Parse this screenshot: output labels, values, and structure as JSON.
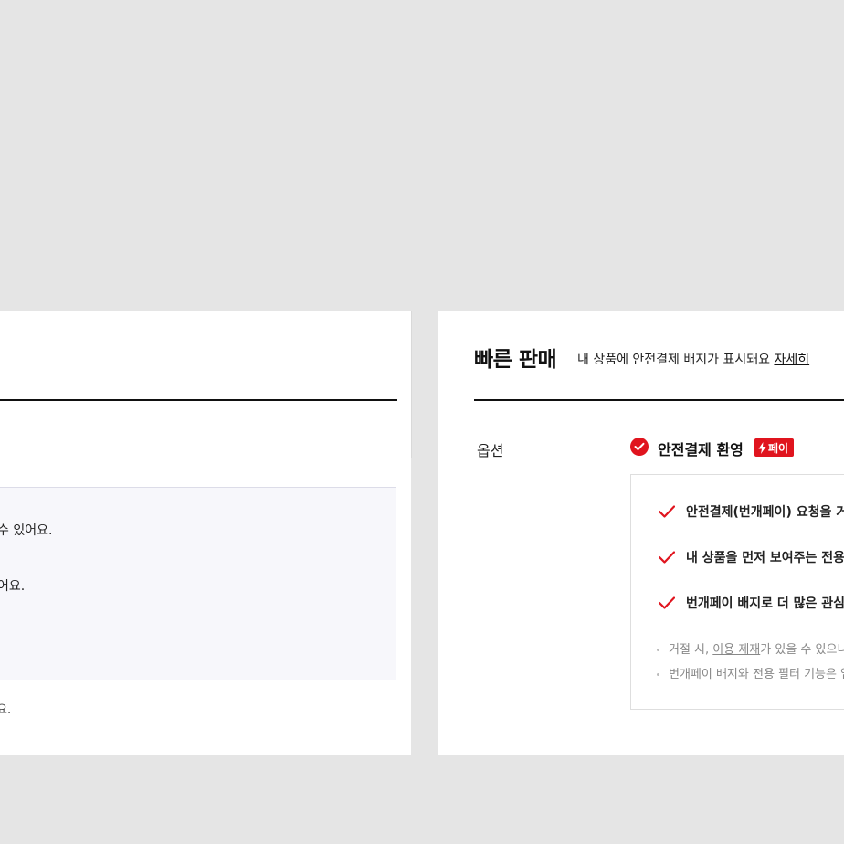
{
  "left_panel": {
    "line1": "수 있어요.",
    "line2": "어요.",
    "line3": "요."
  },
  "right_panel": {
    "title": "빠른 판매",
    "subtitle": "내 상품에 안전결제 배지가 표시돼요",
    "detail_link": "자세히",
    "option_label": "옵션",
    "option_name": "안전결제 환영",
    "pay_badge": "페이",
    "benefits": [
      "안전결제(번개페이) 요청을 거",
      "내 상품을 먼저 보여주는 전용",
      "번개페이 배지로 더 많은 관심"
    ],
    "note1_prefix": "거절 시, ",
    "note1_link": "이용 제재",
    "note1_suffix": "가 있을 수 있으니",
    "note2": "번개페이 배지와 전용 필터 기능은 앱"
  },
  "colors": {
    "accent": "#e0141e",
    "background": "#e5e5e5"
  }
}
